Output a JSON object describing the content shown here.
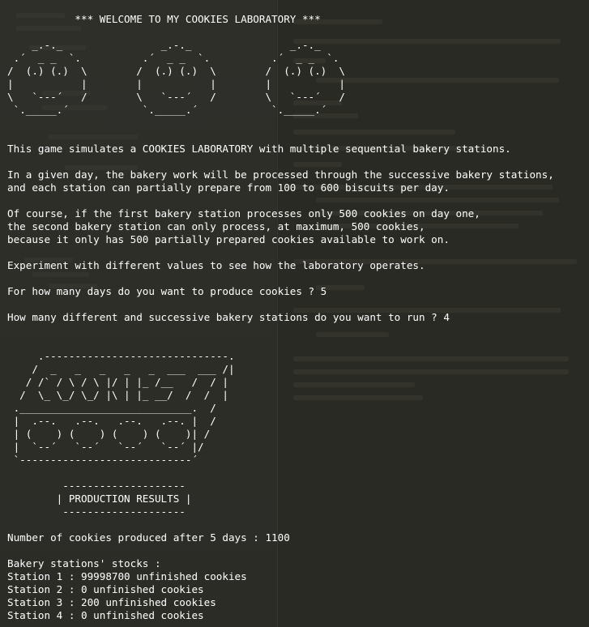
{
  "terminal": {
    "lines": [
      "",
      "           *** WELCOME TO MY COOKIES LABORATORY ***",
      "",
      "    _.-._                _.-._                _.-._",
      " .´  _ _  `.          .´  _ _  `.          .´  _ _  `.",
      "/  (.) (.)  \\        /  (.) (.)  \\        /  (.) (.)  \\",
      "|           |        |           |        |           |",
      "\\   `---´   /        \\   `---´   /        \\   `---´   /",
      " `._____.´            `._____.´            `._____.´",
      "",
      "",
      "This game simulates a COOKIES LABORATORY with multiple sequential bakery stations.",
      "",
      "In a given day, the bakery work will be processed through the successive bakery stations,",
      "and each station can partially prepare from 100 to 600 biscuits per day.",
      "",
      "Of course, if the first bakery station processes only 500 cookies on day one,",
      "the second bakery station can only process, at maximum, 500 cookies,",
      "because it only has 500 partially prepared cookies available to work on.",
      "",
      "Experiment with different values to see how the laboratory operates.",
      "",
      "For how many days do you want to produce cookies ? 5",
      "",
      "How many different and successive bakery stations do you want to run ? 4",
      "",
      "",
      "     .------------------------------.",
      "    /  _   _   _   _   _  ___  ___ /|",
      "   / /` / \\ / \\ |/ | |_ /__   /  / |",
      "  /  \\_ \\_/ \\_/ |\\ | |_ __/  /  /  |",
      " .____________________________.  /",
      " |  .--.   .--.   .--.   .--. |  /",
      " | (    ) (    ) (    ) (    )| /",
      " |  `--´   `--´   `--´   `--´ |/",
      " `----------------------------´",
      "",
      "         --------------------",
      "        | PRODUCTION RESULTS |",
      "         --------------------",
      "",
      "Number of cookies produced after 5 days : 1100",
      "",
      "Bakery stations' stocks :",
      "Station 1 : 99998700 unfinished cookies",
      "Station 2 : 0 unfinished cookies",
      "Station 3 : 200 unfinished cookies",
      "Station 4 : 0 unfinished cookies"
    ]
  }
}
